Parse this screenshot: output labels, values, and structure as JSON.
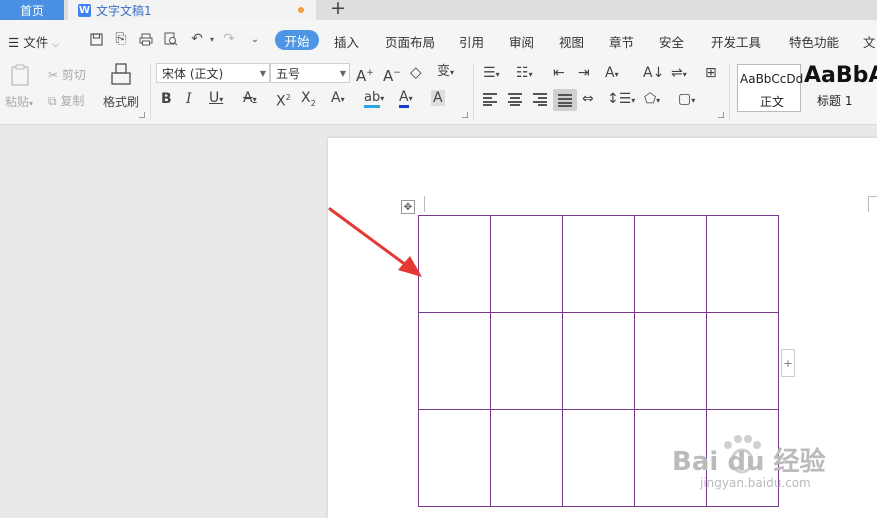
{
  "tabs": {
    "home": "首页",
    "document": "文字文稿1"
  },
  "menu": {
    "file": "文件",
    "active": "开始",
    "items": [
      "插入",
      "页面布局",
      "引用",
      "审阅",
      "视图",
      "章节",
      "安全",
      "开发工具",
      "特色功能",
      "文"
    ]
  },
  "ribbon": {
    "paste": "粘贴",
    "cut": "剪切",
    "copy": "复制",
    "format_painter": "格式刷",
    "font_name": "宋体 (正文)",
    "font_size": "五号",
    "style_normal_preview": "AaBbCcDd",
    "style_normal_label": "正文",
    "style_heading_preview": "AaBbA",
    "style_heading_label": "标题 1"
  },
  "watermark": {
    "brand": "Bai du 经验",
    "url": "jingyan.baidu.com"
  },
  "table": {
    "rows": 3,
    "cols": 5
  },
  "colors": {
    "accent": "#4e95e6",
    "table_border": "#7a3b8e",
    "arrow": "#e53935"
  }
}
